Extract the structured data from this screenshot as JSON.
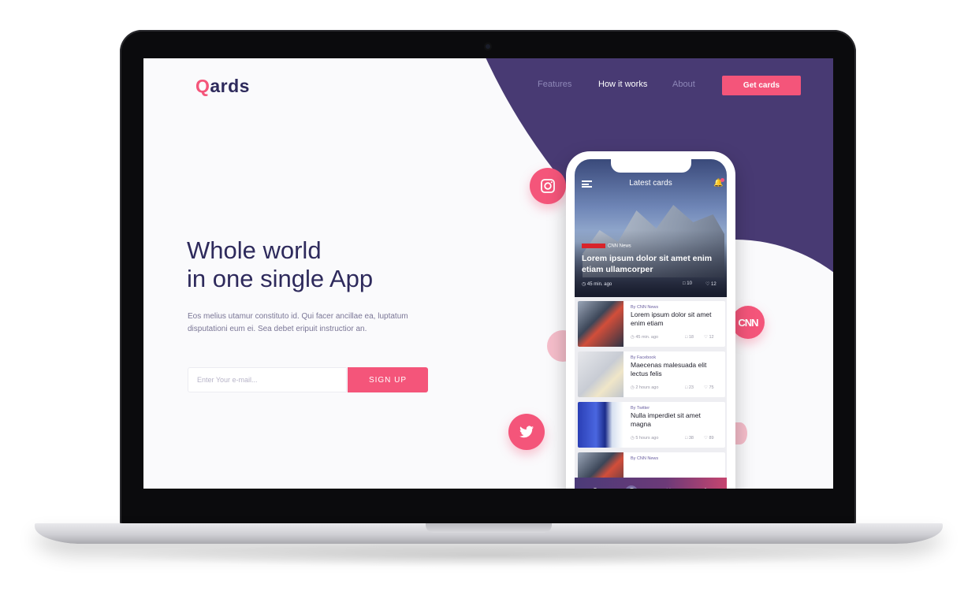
{
  "brand": {
    "logo_text_a": "Q",
    "logo_text_b": "ards"
  },
  "nav": {
    "features": "Features",
    "how_it_works": "How it works",
    "about": "About",
    "cta": "Get cards"
  },
  "hero": {
    "headline_line1": "Whole world",
    "headline_line2": "in one single App",
    "description": "Eos melius utamur constituto id. Qui facer ancillae ea, luptatum disputationi eum ei. Sea debet eripuit instructior an."
  },
  "signup": {
    "email_placeholder": "Enter Your e-mail...",
    "button_label": "SIGN UP"
  },
  "social_icons": [
    "instagram-icon",
    "cnn-logo",
    "twitter-icon"
  ],
  "cnn_text": "CNN",
  "colors": {
    "accent": "#f4557a",
    "navy": "#2e2a5c",
    "purple": "#483a73"
  },
  "phone": {
    "title": "Latest cards",
    "featured": {
      "source": "CNN News",
      "headline": "Lorem ipsum dolor sit amet enim etiam ullamcorper",
      "time": "45 min. ago",
      "comments": "10",
      "likes": "12"
    },
    "cards": [
      {
        "source": "By CNN News",
        "title": "Lorem ipsum dolor sit amet enim etiam",
        "time": "45 min. ago",
        "comments": "18",
        "likes": "12"
      },
      {
        "source": "By Facebook",
        "title": "Maecenas malesuada elit lectus felis",
        "time": "2 hours ago",
        "comments": "23",
        "likes": "75"
      },
      {
        "source": "By Twitter",
        "title": "Nulla imperdiet sit amet magna",
        "time": "5 hours ago",
        "comments": "38",
        "likes": "89"
      },
      {
        "source": "By CNN News",
        "title": "",
        "time": "",
        "comments": "",
        "likes": ""
      }
    ],
    "tabs": [
      "search-icon",
      "globe-icon",
      "heart-icon",
      "share-icon"
    ]
  }
}
